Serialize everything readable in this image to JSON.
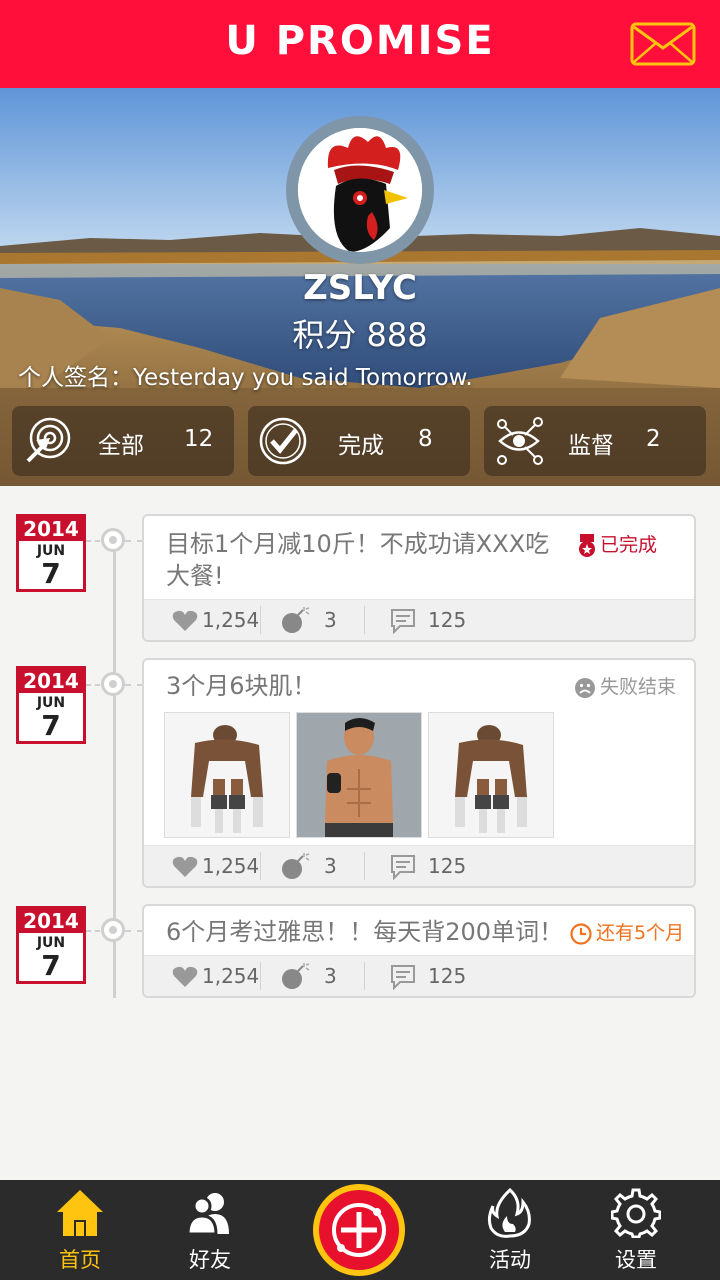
{
  "app": {
    "title": "U PROMISE"
  },
  "header": {
    "mail_icon": "mail-icon"
  },
  "profile": {
    "username": "ZSLYC",
    "points": "积分 888",
    "signature": "个人签名：Yesterday you said Tomorrow."
  },
  "stats": [
    {
      "label": "全部",
      "count": "12",
      "icon": "target-arrow-icon"
    },
    {
      "label": "完成",
      "count": "8",
      "icon": "check-circle-icon"
    },
    {
      "label": "监督",
      "count": "2",
      "icon": "eye-network-icon"
    }
  ],
  "timeline": [
    {
      "date": {
        "year": "2014",
        "month": "JUN",
        "day": "7"
      },
      "text_line1": "目标1个月减10斤！不成功请XXX吃",
      "text_line2": "大餐!",
      "status": "已完成",
      "status_color": "#c8102e",
      "likes": "1,254",
      "bombs": "3",
      "comments": "125"
    },
    {
      "date": {
        "year": "2014",
        "month": "JUN",
        "day": "7"
      },
      "text_line1": "3个月6块肌！",
      "status": "失败结束",
      "status_color": "#999999",
      "likes": "1,254",
      "bombs": "3",
      "comments": "125"
    },
    {
      "date": {
        "year": "2014",
        "month": "JUN",
        "day": "7"
      },
      "text_line1": "6个月考过雅思！！每天背200单词！",
      "status": "还有5个月",
      "status_color": "#f0721c",
      "likes": "1,254",
      "bombs": "3",
      "comments": "125"
    }
  ],
  "nav": [
    {
      "label": "首页",
      "icon": "home-icon",
      "active": true
    },
    {
      "label": "好友",
      "icon": "friends-icon"
    },
    {
      "label": "",
      "icon": "add-promise-icon"
    },
    {
      "label": "活动",
      "icon": "flame-icon"
    },
    {
      "label": "设置",
      "icon": "gear-icon"
    }
  ],
  "colors": {
    "brand": "#ff0f3a",
    "accent": "#ffc40f",
    "nav_bg": "#2b2b2b"
  }
}
